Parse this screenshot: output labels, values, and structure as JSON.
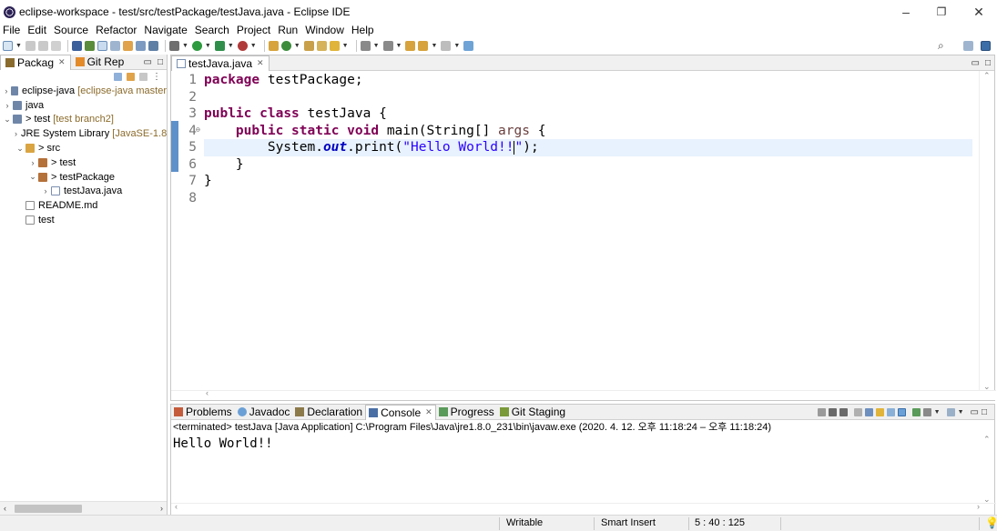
{
  "window": {
    "title": "eclipse-workspace - test/src/testPackage/testJava.java - Eclipse IDE",
    "minimize": "–",
    "maximize": "❐",
    "close": "✕"
  },
  "menu": [
    "File",
    "Edit",
    "Source",
    "Refactor",
    "Navigate",
    "Search",
    "Project",
    "Run",
    "Window",
    "Help"
  ],
  "left_panel": {
    "tabs": [
      {
        "label": "Packag",
        "active": true,
        "icon": "package-explorer-icon"
      },
      {
        "label": "Git Rep",
        "active": false,
        "icon": "git-repositories-icon"
      }
    ],
    "tree": [
      {
        "indent": 0,
        "twisty": "›",
        "icon": "project-icon",
        "label": "eclipse-java",
        "extra": "[eclipse-java master"
      },
      {
        "indent": 0,
        "twisty": "›",
        "icon": "project-icon",
        "label": "java",
        "extra": ""
      },
      {
        "indent": 0,
        "twisty": "⌄",
        "icon": "project-icon",
        "label": "> test",
        "extra": "[test branch2]"
      },
      {
        "indent": 1,
        "twisty": "›",
        "icon": "library-icon",
        "label": "JRE System Library",
        "extra": "[JavaSE-1.8"
      },
      {
        "indent": 1,
        "twisty": "⌄",
        "icon": "source-folder-icon",
        "label": "> src",
        "extra": ""
      },
      {
        "indent": 2,
        "twisty": "›",
        "icon": "package-icon",
        "label": "> test",
        "extra": ""
      },
      {
        "indent": 2,
        "twisty": "⌄",
        "icon": "package-icon",
        "label": "> testPackage",
        "extra": ""
      },
      {
        "indent": 3,
        "twisty": "›",
        "icon": "java-file-icon",
        "label": "testJava.java",
        "extra": ""
      },
      {
        "indent": 1,
        "twisty": "",
        "icon": "file-icon",
        "label": "README.md",
        "extra": ""
      },
      {
        "indent": 1,
        "twisty": "",
        "icon": "file-icon",
        "label": "test",
        "extra": ""
      }
    ]
  },
  "editor": {
    "tab_label": "testJava.java",
    "line_numbers": [
      "1",
      "2",
      "3",
      "4",
      "5",
      "6",
      "7",
      "8"
    ]
  },
  "console": {
    "tabs": [
      "Problems",
      "Javadoc",
      "Declaration",
      "Console",
      "Progress",
      "Git Staging"
    ],
    "active_tab": "Console",
    "terminated_line": "<terminated> testJava [Java Application] C:\\Program Files\\Java\\jre1.8.0_231\\bin\\javaw.exe  (2020. 4. 12. 오후 11:18:24 – 오후 11:18:24)",
    "output": "Hello World!!"
  },
  "status": {
    "writable": "Writable",
    "insert_mode": "Smart Insert",
    "position": "5 : 40 : 125"
  },
  "colors": {
    "keyword": "#7f0055",
    "string": "#2a00ff",
    "field": "#0000c0",
    "current_line": "#e8f2fe",
    "change_bar": "#5e91c9"
  }
}
